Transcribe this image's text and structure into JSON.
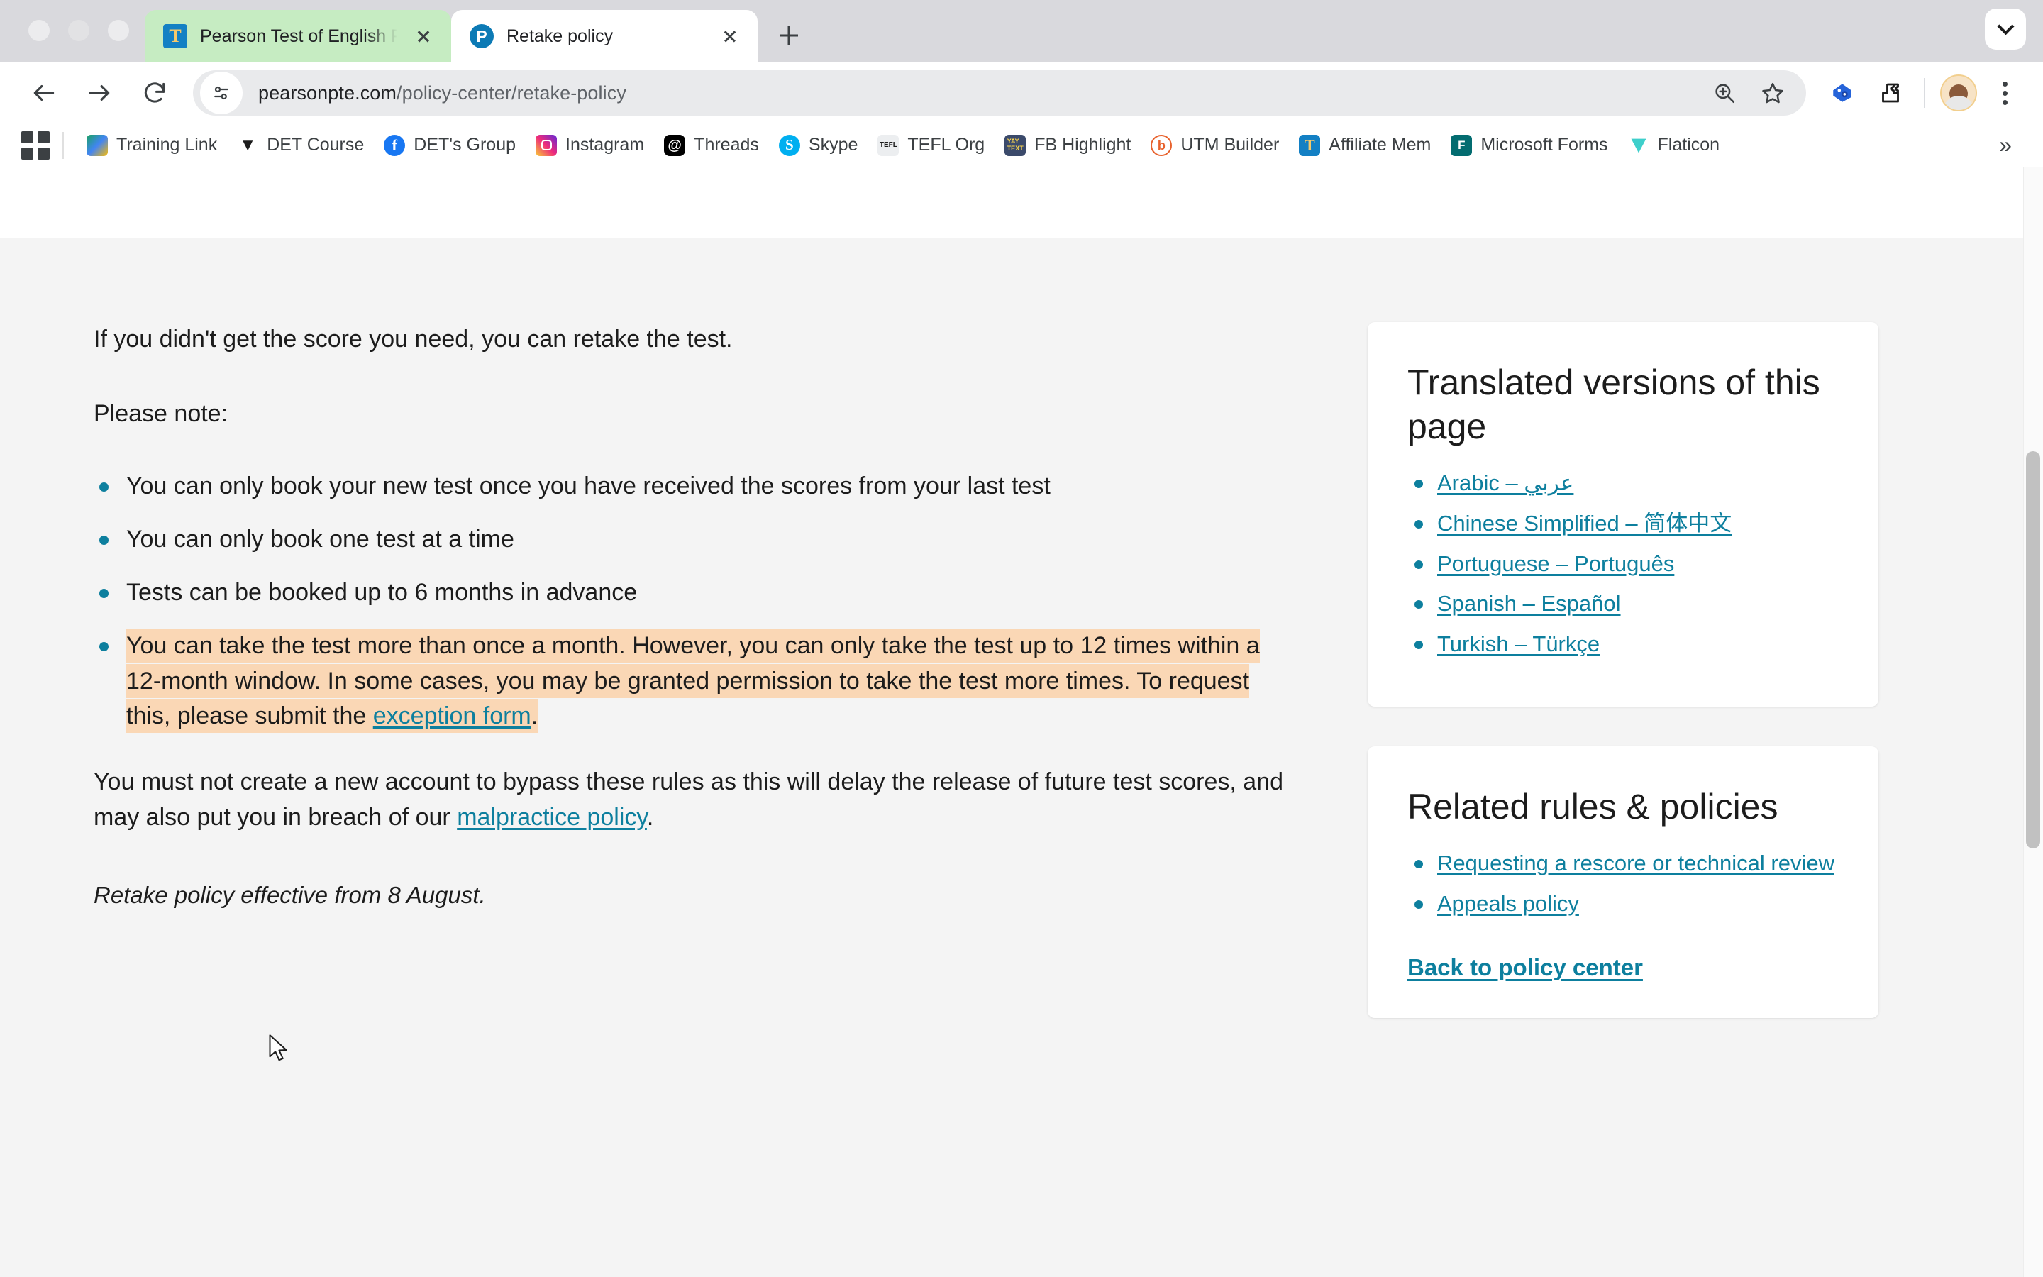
{
  "browser": {
    "tabs": [
      {
        "title": "Pearson Test of English Pract",
        "favicon": "pearson-t-icon",
        "active": false
      },
      {
        "title": "Retake policy",
        "favicon": "pearson-p-icon",
        "active": true
      }
    ],
    "new_tab_label": "+",
    "tab_list_chevron": "chevron-down-icon",
    "toolbar": {
      "back": "back-arrow-icon",
      "forward": "forward-arrow-icon",
      "reload": "reload-icon",
      "site_info": "site-settings-icon",
      "url_domain": "pearsonpte.com",
      "url_path": "/policy-center/retake-policy",
      "zoom": "zoom-in-icon",
      "bookmark": "star-icon",
      "extension_blue": "tag-settings-extension-icon",
      "extension_puzzle": "puzzle-extension-icon",
      "profile": "avatar",
      "menu": "three-dot-menu-icon"
    },
    "bookmarks": {
      "apps_icon": "apps-grid-icon",
      "overflow": "»",
      "items": [
        {
          "label": "Training Link",
          "icon": "google-drive-icon"
        },
        {
          "label": "DET Course",
          "icon": "duolingo-test-icon"
        },
        {
          "label": "DET's Group",
          "icon": "facebook-icon"
        },
        {
          "label": "Instagram",
          "icon": "instagram-icon"
        },
        {
          "label": "Threads",
          "icon": "threads-icon"
        },
        {
          "label": "Skype",
          "icon": "skype-icon"
        },
        {
          "label": "TEFL Org",
          "icon": "tefl-org-icon"
        },
        {
          "label": "FB Highlight",
          "icon": "fb-highlight-icon"
        },
        {
          "label": "UTM Builder",
          "icon": "utm-builder-icon"
        },
        {
          "label": "Affiliate Mem",
          "icon": "pearson-t-icon"
        },
        {
          "label": "Microsoft Forms",
          "icon": "microsoft-forms-icon"
        },
        {
          "label": "Flaticon",
          "icon": "flaticon-icon"
        }
      ]
    }
  },
  "page": {
    "lead": "If you didn't get the score you need, you can retake the test.",
    "note_label": "Please note:",
    "rules": [
      "You can only book your new test once you have received the scores from your last test",
      "You can only book one test at a time",
      "Tests can be booked up to 6 months in advance"
    ],
    "highlighted_rule": {
      "text_before_link": "You can take the test more than once a month. However, you can only take the test up to 12 times within a 12-month window. In some cases, you may be granted permission to take the test more times. To request this, please submit the ",
      "link_text": "exception form",
      "text_after_link": ".",
      "highlight_color": "#fad7b5"
    },
    "warning_before_link": "You must not create a new account to bypass these rules as this will delay the release of future test scores, and may also put you in breach of our ",
    "warning_link": "malpractice policy",
    "warning_after_link": ".",
    "effective_note": "Retake policy effective from 8 August.",
    "link_color": "#0d7f9e"
  },
  "sidebar": {
    "translated": {
      "heading": "Translated versions of this page",
      "links": [
        "Arabic – عربي",
        "Chinese Simplified – 简体中文",
        "Portuguese – Português",
        "Spanish – Español",
        "Turkish – Türkçe"
      ]
    },
    "related": {
      "heading": "Related rules & policies",
      "links": [
        "Requesting a rescore or technical review",
        "Appeals policy"
      ],
      "back_link": "Back to policy center"
    }
  }
}
